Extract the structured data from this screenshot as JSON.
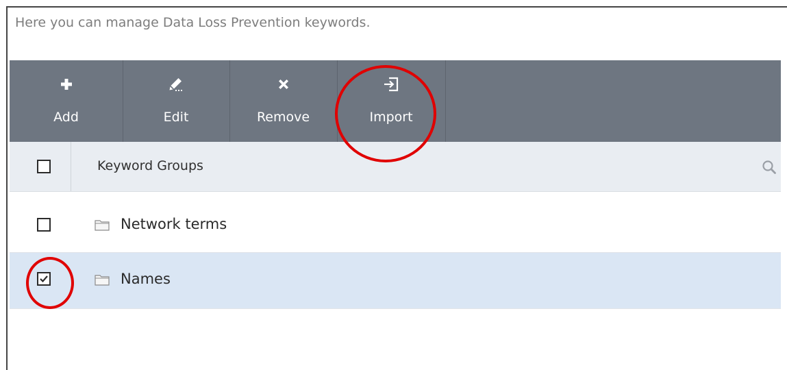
{
  "intro_text": "Here you can manage Data Loss Prevention keywords.",
  "toolbar": {
    "buttons": [
      {
        "label": "Add",
        "icon": "plus-icon"
      },
      {
        "label": "Edit",
        "icon": "pencil-icon"
      },
      {
        "label": "Remove",
        "icon": "x-icon"
      },
      {
        "label": "Import",
        "icon": "import-icon"
      }
    ]
  },
  "table": {
    "column_header": "Keyword Groups",
    "rows": [
      {
        "label": "Network terms",
        "checked": false,
        "selected": false
      },
      {
        "label": "Names",
        "checked": true,
        "selected": true
      }
    ]
  },
  "colors": {
    "toolbar_bg": "#6e7681",
    "header_bg": "#e9edf2",
    "selected_row_bg": "#dae6f4",
    "annotation_red": "#e00000"
  }
}
